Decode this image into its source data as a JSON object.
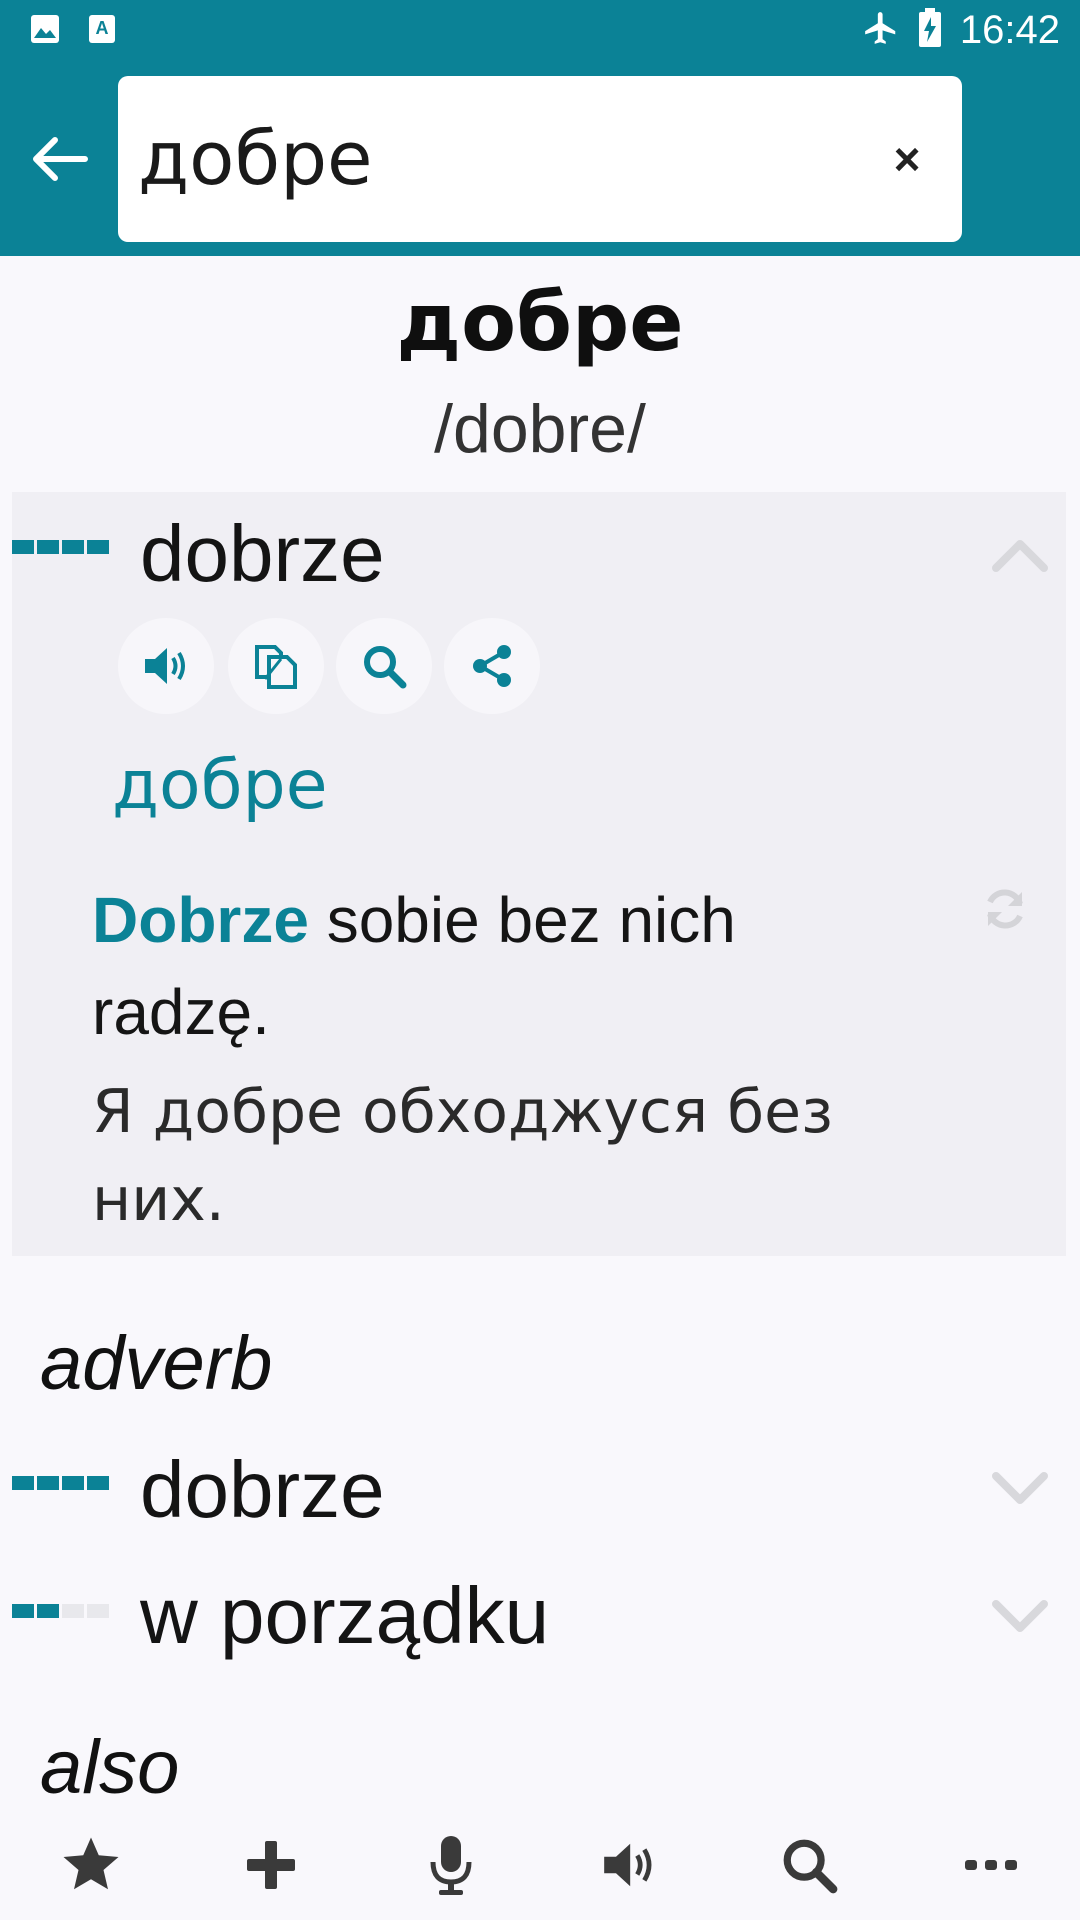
{
  "status_bar": {
    "time": "16:42",
    "icons": [
      "image-icon",
      "text-a-icon",
      "airplane-icon",
      "battery-charging-icon"
    ]
  },
  "search": {
    "query": "добре",
    "clear_label": "×"
  },
  "entry": {
    "headword": "добре",
    "pronunciation": "/dobre/"
  },
  "expanded": {
    "translation": "dobrze",
    "frequency": 4,
    "native_word": "добре",
    "example_highlight": "Dobrze",
    "example_rest": " sobie bez nich radzę.",
    "example_translation": "Я добре обходжуся без них.",
    "actions": [
      "speaker-icon",
      "copy-icon",
      "search-icon",
      "share-icon"
    ]
  },
  "sections": [
    {
      "pos": "adverb",
      "items": [
        {
          "word": "dobrze",
          "frequency": 4
        },
        {
          "word": "w porządku",
          "frequency": 2
        }
      ]
    },
    {
      "pos": "also",
      "items": []
    }
  ],
  "bottom_bar": [
    "star-icon",
    "plus-icon",
    "microphone-icon",
    "speaker-icon",
    "search-icon",
    "more-icon"
  ],
  "colors": {
    "accent": "#0b8296",
    "background": "#f9f8fc"
  }
}
